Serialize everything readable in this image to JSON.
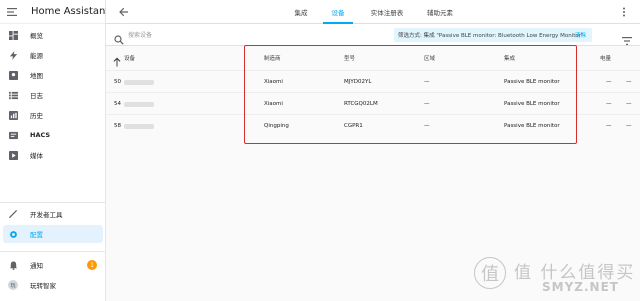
{
  "app": {
    "title": "Home Assistant"
  },
  "sidebar": {
    "items": [
      {
        "label": "概览",
        "icon": "dashboard-icon"
      },
      {
        "label": "能源",
        "icon": "lightning-icon"
      },
      {
        "label": "地图",
        "icon": "map-icon"
      },
      {
        "label": "日志",
        "icon": "list-icon"
      },
      {
        "label": "历史",
        "icon": "chart-icon"
      },
      {
        "label": "HACS",
        "icon": "hacs-icon"
      },
      {
        "label": "媒体",
        "icon": "media-icon"
      }
    ],
    "developer_tools": "开发者工具",
    "settings": "配置",
    "notifications": "通知",
    "notifications_count": "1",
    "user_initials": "玩",
    "user_name": "玩转智家"
  },
  "header": {
    "tabs": [
      {
        "label": "集成",
        "active": false
      },
      {
        "label": "设备",
        "active": true
      },
      {
        "label": "实体注册表",
        "active": false
      },
      {
        "label": "辅助元素",
        "active": false
      }
    ]
  },
  "search": {
    "placeholder": "搜索设备",
    "filter_text": "筛选方式: 集成 \"Passive BLE monitor: Bluetooth Low Energy Monitor\"",
    "clear_label": "清除"
  },
  "table": {
    "columns": {
      "device": "设备",
      "manufacturer": "制造商",
      "model": "型号",
      "area": "区域",
      "integration": "集成",
      "battery": "电量"
    },
    "rows": [
      {
        "device_prefix": "50",
        "manufacturer": "Xiaomi",
        "model": "MJYD02YL",
        "area": "—",
        "integration": "Passive BLE monitor",
        "battery": "—",
        "extra": "—"
      },
      {
        "device_prefix": "54",
        "manufacturer": "Xiaomi",
        "model": "RTCGQ02LM",
        "area": "—",
        "integration": "Passive BLE monitor",
        "battery": "—",
        "extra": "—"
      },
      {
        "device_prefix": "58",
        "manufacturer": "Qingping",
        "model": "CGPR1",
        "area": "—",
        "integration": "Passive BLE monitor",
        "battery": "—",
        "extra": "—"
      }
    ]
  },
  "watermark": {
    "chinese": "值 什么值得买",
    "english": "SMYZ.NET",
    "logo": "值"
  },
  "colors": {
    "accent": "#03a9f4",
    "highlight": "#d32f2f",
    "badge": "#ff9800"
  }
}
